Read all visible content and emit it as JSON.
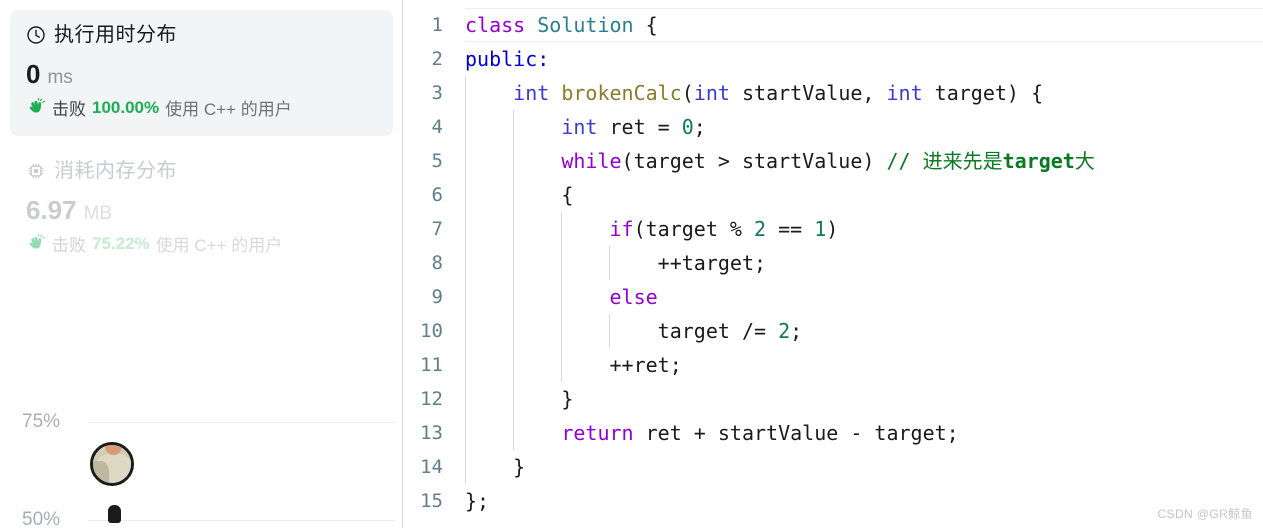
{
  "left_panel": {
    "runtime_card": {
      "icon": "clock-icon",
      "title": "执行用时分布",
      "value": "0",
      "unit": "ms",
      "beat_icon": "waving-hand-icon",
      "beat_prefix": "击败",
      "beat_percent": "100.00%",
      "beat_suffix": "使用 C++ 的用户",
      "state": "selected",
      "accent_color": "#1cae52",
      "background_color": "#f3f4f5"
    },
    "memory_card": {
      "icon": "cpu-chip-icon",
      "title": "消耗内存分布",
      "value": "6.97",
      "unit": "MB",
      "beat_icon": "waving-hand-icon",
      "beat_prefix": "击败",
      "beat_percent": "75.22%",
      "beat_suffix": "使用 C++ 的用户",
      "state": "dimmed",
      "accent_color": "#7ed69e"
    },
    "scrollbar": {
      "name": "left-panel-scrollbar",
      "thumb_position": "bottom"
    }
  },
  "chart_data": {
    "type": "scatter",
    "title": "",
    "xlabel": "",
    "ylabel": "",
    "grid": true,
    "legend_position": "none",
    "y_tick_labels": [
      "75%",
      "50%"
    ],
    "y_ticks": [
      75,
      50
    ],
    "ylim": [
      50,
      75
    ],
    "points": [
      {
        "name": "user-avatar-point",
        "y_percent": 63,
        "x_relative": 0.02,
        "marker": "avatar-image"
      },
      {
        "name": "current-submission-marker",
        "y_percent": 50,
        "x_relative": 0.07,
        "marker": "pin"
      }
    ]
  },
  "code": {
    "language": "C++",
    "lines": [
      {
        "n": "1"
      },
      {
        "n": "2"
      },
      {
        "n": "3"
      },
      {
        "n": "4"
      },
      {
        "n": "5"
      },
      {
        "n": "6"
      },
      {
        "n": "7"
      },
      {
        "n": "8"
      },
      {
        "n": "9"
      },
      {
        "n": "10"
      },
      {
        "n": "11"
      },
      {
        "n": "12"
      },
      {
        "n": "13"
      },
      {
        "n": "14"
      },
      {
        "n": "15"
      }
    ],
    "line_numbers": [
      "1",
      "2",
      "3",
      "4",
      "5",
      "6",
      "7",
      "8",
      "9",
      "10",
      "11",
      "12",
      "13",
      "14",
      "15"
    ],
    "plain_text": [
      "class Solution {",
      "public:",
      "    int brokenCalc(int startValue, int target) {",
      "        int ret = 0;",
      "        while(target > startValue) // 进来先是target大",
      "        {",
      "            if(target % 2 == 1)",
      "                ++target;",
      "            else",
      "                target /= 2;",
      "            ++ret;",
      "        }",
      "        return ret + startValue - target;",
      "    }",
      "};"
    ],
    "tokens": {
      "l1_class": "class",
      "l1_name": "Solution",
      "l1_brace": " {",
      "l2_public": "public:",
      "l3_int": "int",
      "l3_fn": "brokenCalc",
      "l3_p1_type": "int",
      "l3_p1_name": "startValue",
      "l3_comma": ", ",
      "l3_p2_type": "int",
      "l3_p2_name": "target",
      "l3_tail": ") {",
      "l4_int": "int",
      "l4_rest": "ret = ",
      "l4_zero": "0",
      "l4_semi": ";",
      "l5_while": "while",
      "l5_cond": "(target > startValue) ",
      "l5_cmt_slash": "// ",
      "l5_cmt_a": "进来先是",
      "l5_cmt_b": "target",
      "l5_cmt_c": "大",
      "l6_brace": "{",
      "l7_if": "if",
      "l7_a": "(target % ",
      "l7_two": "2",
      "l7_b": " == ",
      "l7_one": "1",
      "l7_c": ")",
      "l8_text": "++target;",
      "l9_else": "else",
      "l10_a": "target /= ",
      "l10_two": "2",
      "l10_b": ";",
      "l11_text": "++ret;",
      "l12_brace": "}",
      "l13_return": "return",
      "l13_rest": " ret + startValue - target;",
      "l14_brace": "}",
      "l15_brace": "};"
    },
    "colors": {
      "keyword": "#9400d3",
      "keyword_alt": "#0000d8",
      "type": "#3a3ad8",
      "class_name": "#2a7f8f",
      "function": "#8a7b2a",
      "number": "#0f7a5a",
      "comment": "#0a7a22",
      "plain": "#1b1b1b",
      "line_number": "#5f7f8d"
    }
  },
  "watermark": "CSDN @GR鲸鱼"
}
